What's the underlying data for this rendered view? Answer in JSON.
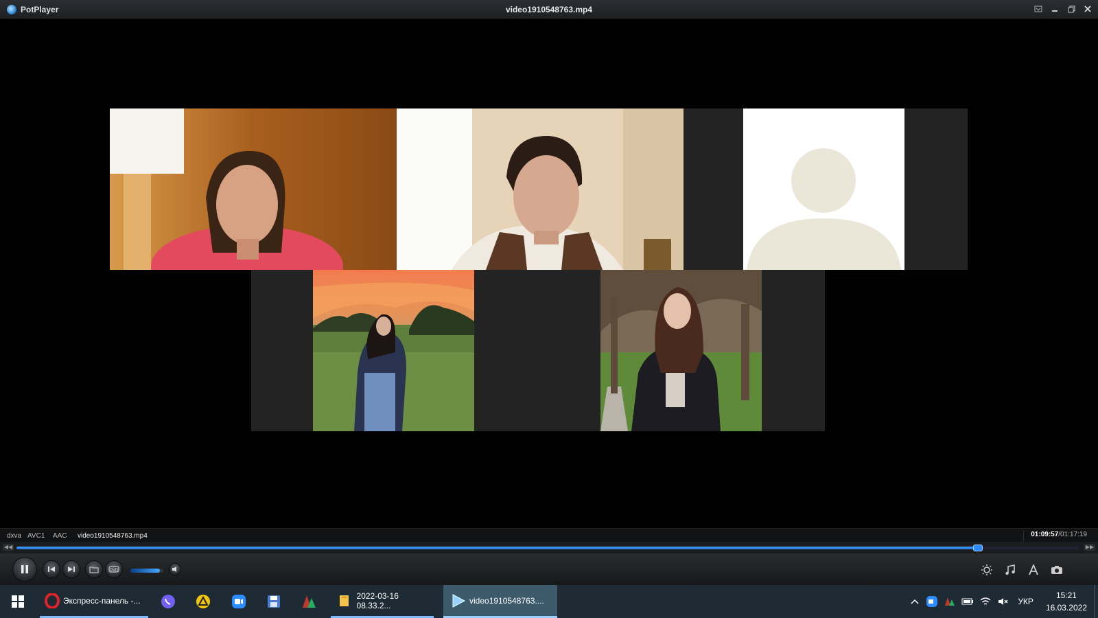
{
  "window": {
    "app_name": "PotPlayer",
    "title": "video1910548763.mp4"
  },
  "video": {
    "participants": [
      {
        "type": "camera",
        "scene": "woman-red-shirt-orange-room"
      },
      {
        "type": "camera",
        "scene": "woman-vest-beige-room"
      },
      {
        "type": "avatar",
        "scene": "placeholder-silhouette"
      },
      {
        "type": "camera",
        "scene": "girl-sunset-field"
      },
      {
        "type": "camera",
        "scene": "girl-park-autumn"
      }
    ]
  },
  "infobar": {
    "decoder": "dxva",
    "video_codec": "AVC1",
    "audio_codec": "AAC",
    "filename": "video1910548763.mp4",
    "current_time": "01:09:57",
    "total_time": "/01:17:19"
  },
  "playback": {
    "progress": 0.905,
    "volume": 0.9
  },
  "controls": {
    "icons": [
      "pause-icon",
      "previous-icon",
      "next-icon",
      "open-folder-icon",
      "dvd-icon",
      "speaker-icon",
      "brightness-icon",
      "music-icon",
      "subtitle-icon",
      "camera-icon"
    ]
  },
  "taskbar": {
    "items": [
      {
        "label": "Экспресс-панель -...",
        "icon": "opera-icon",
        "color": "#e0242b"
      },
      {
        "label": "",
        "icon": "viber-icon",
        "color": "#7360f2"
      },
      {
        "label": "",
        "icon": "warning-icon",
        "color": "#f1c40f"
      },
      {
        "label": "",
        "icon": "zoom-icon",
        "color": "#2d8cff"
      },
      {
        "label": "",
        "icon": "save-icon",
        "color": "#4a7bd0"
      },
      {
        "label": "",
        "icon": "app-icon",
        "color": "#c0392b"
      },
      {
        "label": "2022-03-16 08.33.2...",
        "icon": "folder-icon",
        "color": "#f3c44b"
      },
      {
        "label": "video1910548763....",
        "icon": "player-icon",
        "color": "#9ad0ff"
      }
    ],
    "tray": {
      "language": "УКР",
      "time": "15:21",
      "date": "16.03.2022"
    }
  }
}
